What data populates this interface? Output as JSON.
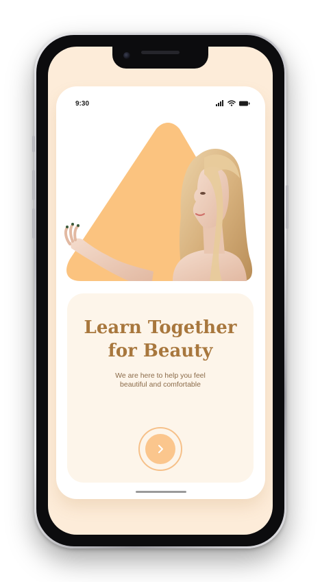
{
  "status_bar": {
    "time": "9:30",
    "icons": [
      "cellular-signal-icon",
      "wifi-icon",
      "battery-icon"
    ]
  },
  "hero": {
    "image": "woman-with-long-blonde-hair-photo",
    "shape": "rounded-triangle",
    "shape_color": "#fbc37f"
  },
  "onboarding": {
    "headline_line1": "Learn Together",
    "headline_line2": "for Beauty",
    "subtitle_line1": "We are here to help you feel",
    "subtitle_line2": "beautiful and comfortable"
  },
  "next_button": {
    "icon": "chevron-right-icon"
  },
  "colors": {
    "accent": "#fbc68d",
    "headline": "#a8773d",
    "panel_bg": "#fdf5ea",
    "screen_bg": "#fdecd9"
  }
}
